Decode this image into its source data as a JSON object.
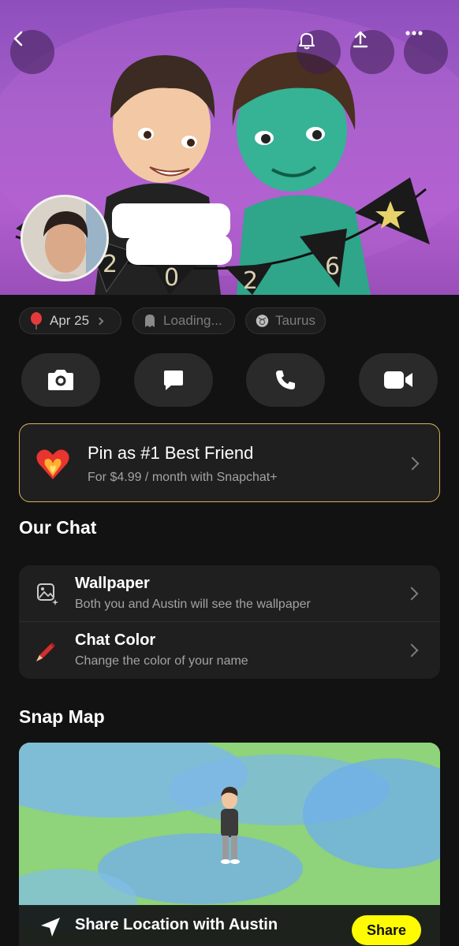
{
  "header": {
    "back_icon": "chevron-left-icon",
    "bell_icon": "bell-icon",
    "share_icon": "upload-icon",
    "more_icon": "more-dots-icon",
    "hero_colors": {
      "top": "#8e4fbd",
      "bottom": "#9a4fb8"
    }
  },
  "chips": [
    {
      "icon": "balloon-icon",
      "label": "Apr 25"
    },
    {
      "icon": "ghost-icon",
      "label": "Loading..."
    },
    {
      "icon": "taurus-icon",
      "label": "Taurus"
    }
  ],
  "actions": [
    {
      "icon": "camera-icon"
    },
    {
      "icon": "chat-icon"
    },
    {
      "icon": "phone-icon"
    },
    {
      "icon": "video-icon"
    }
  ],
  "pin_card": {
    "title": "Pin as #1 Best Friend",
    "subtitle": "For $4.99 / month with Snapchat+",
    "border_color": "#d9b25b"
  },
  "our_chat": {
    "title": "Our Chat",
    "items": [
      {
        "title": "Wallpaper",
        "subtitle": "Both you and Austin will see the wallpaper"
      },
      {
        "title": "Chat Color",
        "subtitle": "Change the color of your name"
      }
    ]
  },
  "snap_map": {
    "title": "Snap Map",
    "share_label": "Share Location with Austin",
    "share_button": "Share",
    "accent": "#fffc00"
  }
}
